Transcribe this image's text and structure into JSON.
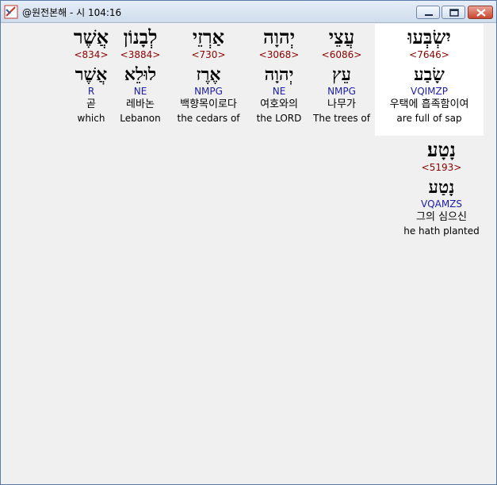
{
  "window": {
    "title": "@원전본해 - 시 104:16",
    "buttons": {
      "minimize": "minimize",
      "maximize": "maximize",
      "close": "close"
    }
  },
  "words": [
    {
      "hebrew": "יִשְׂבְּעוּ",
      "strong": "<7646>",
      "lemma": "שָׂבַע",
      "morph": "VQIMZP",
      "korean": "우택에 흡족함이여",
      "english": "are full of sap",
      "highlighted": true
    },
    {
      "hebrew": "עֲצֵי",
      "strong": "<6086>",
      "lemma": "עֵץ",
      "morph": "NMPG",
      "korean": "나무가",
      "english": "The trees of"
    },
    {
      "hebrew": "יְהוָה",
      "strong": "<3068>",
      "lemma": "יְהוָה",
      "morph": "NE",
      "korean": "여호와의",
      "english": "the LORD"
    },
    {
      "hebrew": "אַרְזֵי",
      "strong": "<730>",
      "lemma": "אֶרֶז",
      "morph": "NMPG",
      "korean": "백향목이로다",
      "english": "the cedars of"
    },
    {
      "hebrew": "לְבָנוֹן",
      "strong": "<3884>",
      "lemma": "לוּלֵא",
      "morph": "NE",
      "korean": "레바논",
      "english": "Lebanon"
    },
    {
      "hebrew": "אֲשֶׁר",
      "strong": "<834>",
      "lemma": "אֲשֶׁר",
      "morph": "R",
      "korean": "곧",
      "english": "which"
    },
    {
      "hebrew": "נָטָע׃",
      "strong": "<5193>",
      "lemma": "נָטַע",
      "morph": "VQAMZS",
      "korean": "그의 심으신",
      "english": "he hath planted"
    }
  ]
}
